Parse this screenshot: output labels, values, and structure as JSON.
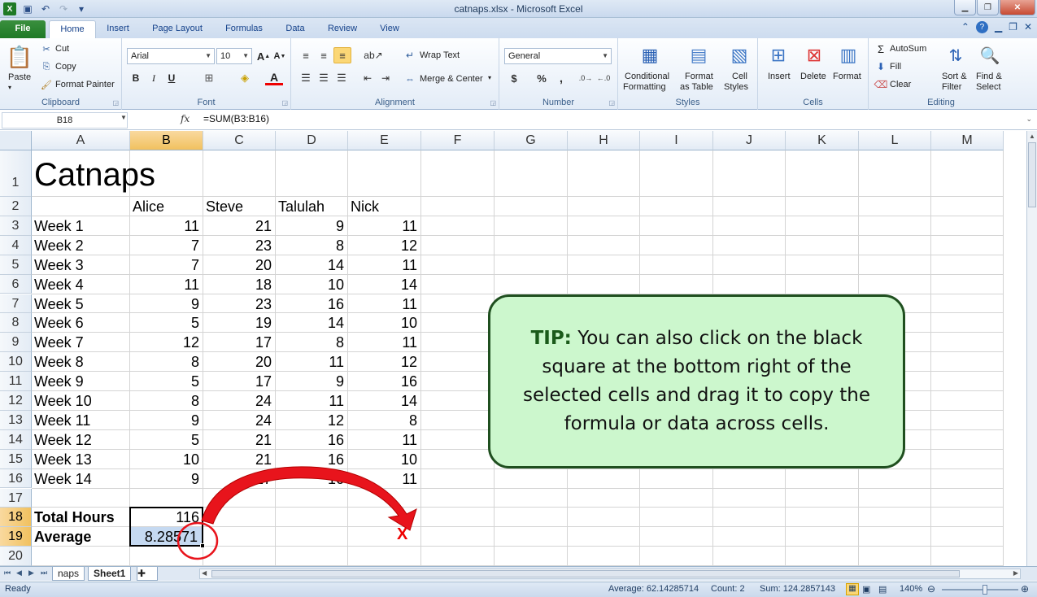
{
  "titlebar": {
    "title": "catnaps.xlsx  -  Microsoft Excel"
  },
  "tabs": [
    "File",
    "Home",
    "Insert",
    "Page Layout",
    "Formulas",
    "Data",
    "Review",
    "View"
  ],
  "ribbon": {
    "clipboard": {
      "paste": "Paste",
      "cut": "Cut",
      "copy": "Copy",
      "format_painter": "Format Painter",
      "label": "Clipboard"
    },
    "font": {
      "family": "Arial",
      "size": "10",
      "bold": "B",
      "italic": "I",
      "underline": "U",
      "label": "Font"
    },
    "alignment": {
      "wrap_text": "Wrap Text",
      "merge_center": "Merge & Center",
      "label": "Alignment"
    },
    "number": {
      "format": "General",
      "currency": "$",
      "percent": "%",
      "comma": ",",
      "label": "Number"
    },
    "styles": {
      "conditional1": "Conditional",
      "conditional2": "Formatting",
      "format_table1": "Format",
      "format_table2": "as Table",
      "cell_styles1": "Cell",
      "cell_styles2": "Styles",
      "label": "Styles"
    },
    "cells": {
      "insert": "Insert",
      "delete": "Delete",
      "format": "Format",
      "label": "Cells"
    },
    "editing": {
      "autosum": "AutoSum",
      "fill": "Fill",
      "clear": "Clear",
      "sort1": "Sort &",
      "sort2": "Filter",
      "find1": "Find &",
      "find2": "Select",
      "label": "Editing"
    }
  },
  "formula_bar": {
    "name_box": "B18",
    "fx": "fx",
    "formula": "=SUM(B3:B16)"
  },
  "columns": [
    "A",
    "B",
    "C",
    "D",
    "E",
    "F",
    "G",
    "H",
    "I",
    "J",
    "K",
    "L",
    "M"
  ],
  "rows": [
    "1",
    "2",
    "3",
    "4",
    "5",
    "6",
    "7",
    "8",
    "9",
    "10",
    "11",
    "12",
    "13",
    "14",
    "15",
    "16",
    "17",
    "18",
    "19",
    "20"
  ],
  "sheet": {
    "title": "Catnaps",
    "headers": [
      "Alice",
      "Steve",
      "Talulah",
      "Nick"
    ],
    "data": [
      {
        "label": "Week 1",
        "values": [
          "11",
          "21",
          "9",
          "11"
        ]
      },
      {
        "label": "Week 2",
        "values": [
          "7",
          "23",
          "8",
          "12"
        ]
      },
      {
        "label": "Week 3",
        "values": [
          "7",
          "20",
          "14",
          "11"
        ]
      },
      {
        "label": "Week 4",
        "values": [
          "11",
          "18",
          "10",
          "14"
        ]
      },
      {
        "label": "Week 5",
        "values": [
          "9",
          "23",
          "16",
          "11"
        ]
      },
      {
        "label": "Week 6",
        "values": [
          "5",
          "19",
          "14",
          "10"
        ]
      },
      {
        "label": "Week 7",
        "values": [
          "12",
          "17",
          "8",
          "11"
        ]
      },
      {
        "label": "Week 8",
        "values": [
          "8",
          "20",
          "11",
          "12"
        ]
      },
      {
        "label": "Week 9",
        "values": [
          "5",
          "17",
          "9",
          "16"
        ]
      },
      {
        "label": "Week 10",
        "values": [
          "8",
          "24",
          "11",
          "14"
        ]
      },
      {
        "label": "Week 11",
        "values": [
          "9",
          "24",
          "12",
          "8"
        ]
      },
      {
        "label": "Week 12",
        "values": [
          "5",
          "21",
          "16",
          "11"
        ]
      },
      {
        "label": "Week 13",
        "values": [
          "10",
          "21",
          "16",
          "10"
        ]
      },
      {
        "label": "Week 14",
        "values": [
          "9",
          "17",
          "16",
          "11"
        ]
      }
    ],
    "total_label": "Total Hours",
    "total_value": "116",
    "average_label": "Average",
    "average_value": "8.28571"
  },
  "tip": {
    "prefix": "TIP:",
    "text": " You can also click on the black square at the bottom right of the selected cells and drag it to copy  the formula or data across cells."
  },
  "annotation": {
    "x_mark": "X",
    "arrow_color": "#e8141c"
  },
  "sheet_tabs": [
    "naps",
    "Sheet1"
  ],
  "status": {
    "mode": "Ready",
    "average": "Average: 62.14285714",
    "count": "Count: 2",
    "sum": "Sum: 124.2857143",
    "zoom": "140%"
  }
}
